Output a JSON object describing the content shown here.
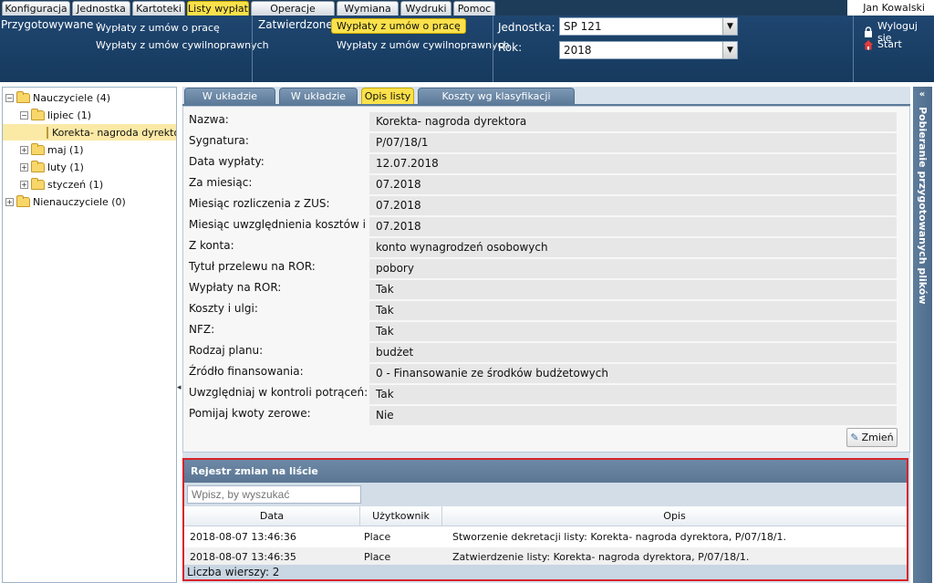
{
  "menu": {
    "tabs": [
      {
        "label": "Konfiguracja"
      },
      {
        "label": "Jednostka"
      },
      {
        "label": "Kartoteki"
      },
      {
        "label": "Listy wypłat"
      },
      {
        "label": "Operacje bieżące"
      },
      {
        "label": "Wymiana"
      },
      {
        "label": "Wydruki"
      },
      {
        "label": "Pomoc"
      }
    ],
    "active": "Listy wypłat",
    "user": "Jan Kowalski"
  },
  "subheader": {
    "prepared_label": "Przygotowywane :",
    "prepared_links": [
      "Wypłaty z umów o pracę",
      "Wypłaty z umów cywilnoprawnych"
    ],
    "approved_label": "Zatwierdzone :",
    "approved_links": [
      "Wypłaty z umów o pracę",
      "Wypłaty z umów cywilnoprawnych"
    ],
    "unit_label": "Jednostka:",
    "unit_value": "SP 121",
    "year_label": "Rok:",
    "year_value": "2018",
    "logout": "Wyloguj się",
    "start": "Start"
  },
  "tree": {
    "nodes": [
      {
        "label": "Nauczyciele (4)",
        "expander": "−"
      },
      {
        "label": "lipiec (1)",
        "expander": "−"
      },
      {
        "label": "Korekta- nagroda dyrektora"
      },
      {
        "label": "maj (1)",
        "expander": "+"
      },
      {
        "label": "luty (1)",
        "expander": "+"
      },
      {
        "label": "styczeń (1)",
        "expander": "+"
      },
      {
        "label": "Nienauczyciele (0)",
        "expander": "+"
      }
    ]
  },
  "main_tabs": [
    {
      "label": "W układzie pasków"
    },
    {
      "label": "W układzie listy"
    },
    {
      "label": "Opis listy"
    },
    {
      "label": "Koszty wg klasyfikacji budżetowej"
    }
  ],
  "active_tab": "Opis listy",
  "form": {
    "fields": [
      {
        "label": "Nazwa:",
        "value": "Korekta- nagroda dyrektora"
      },
      {
        "label": "Sygnatura:",
        "value": "P/07/18/1"
      },
      {
        "label": "Data wypłaty:",
        "value": "12.07.2018"
      },
      {
        "label": "Za miesiąc:",
        "value": "07.2018"
      },
      {
        "label": "Miesiąc rozliczenia z ZUS:",
        "value": "07.2018"
      },
      {
        "label": "Miesiąc uwzględnienia kosztów i ulg:",
        "value": "07.2018"
      },
      {
        "label": "Z konta:",
        "value": "konto wynagrodzeń osobowych"
      },
      {
        "label": "Tytuł przelewu na ROR:",
        "value": "pobory"
      },
      {
        "label": "Wypłaty na ROR:",
        "value": "Tak"
      },
      {
        "label": "Koszty i ulgi:",
        "value": "Tak"
      },
      {
        "label": "NFZ:",
        "value": "Tak"
      },
      {
        "label": "Rodzaj planu:",
        "value": "budżet"
      },
      {
        "label": "Źródło finansowania:",
        "value": "0 - Finansowanie ze środków budżetowych"
      },
      {
        "label": "Uwzględniaj w kontroli potrąceń:",
        "value": "Tak"
      },
      {
        "label": "Pomijaj kwoty zerowe:",
        "value": "Nie"
      }
    ],
    "edit_label": "Zmień"
  },
  "register": {
    "title": "Rejestr zmian na liście",
    "search_placeholder": "Wpisz, by wyszukać",
    "columns": [
      "Data",
      "Użytkownik",
      "Opis"
    ],
    "rows": [
      {
        "date": "2018-08-07 13:46:36",
        "user": "Place",
        "desc": "Stworzenie dekretacji listy: Korekta- nagroda dyrektora, P/07/18/1."
      },
      {
        "date": "2018-08-07 13:46:35",
        "user": "Place",
        "desc": "Zatwierdzenie listy: Korekta- nagroda dyrektora, P/07/18/1."
      }
    ],
    "row_count": "Liczba wierszy: 2"
  },
  "side_panel": {
    "label": "Pobieranie przygotowanych plików",
    "toggle": "«"
  }
}
